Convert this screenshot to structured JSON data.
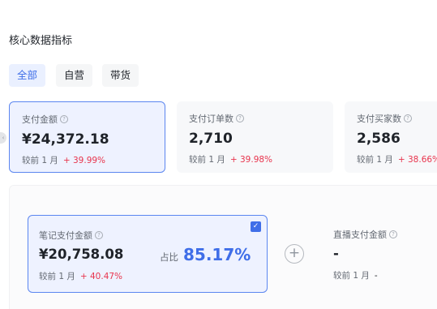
{
  "section": {
    "title": "核心数据指标"
  },
  "tabs": [
    {
      "label": "全部",
      "active": true
    },
    {
      "label": "自营",
      "active": false
    },
    {
      "label": "带货",
      "active": false
    }
  ],
  "metrics": [
    {
      "label": "支付金额",
      "value": "¥24,372.18",
      "compare_label": "较前 1 月",
      "change": "+ 39.99%",
      "active": true
    },
    {
      "label": "支付订单数",
      "value": "2,710",
      "compare_label": "较前 1 月",
      "change": "+ 39.98%",
      "active": false
    },
    {
      "label": "支付买家数",
      "value": "2,586",
      "compare_label": "较前 1 月",
      "change": "+ 38.66%",
      "active": false
    }
  ],
  "breakdown": {
    "notes": {
      "label": "笔记支付金额",
      "value": "¥20,758.08",
      "compare_label": "较前 1 月",
      "change": "+ 40.47%",
      "ratio_label": "占比",
      "ratio_value": "85.17%",
      "selected": true
    },
    "live": {
      "label": "直播支付金额",
      "value": "-",
      "compare_label": "较前 1 月",
      "change": "-"
    }
  },
  "icons": {
    "help": "question-circle-icon",
    "check": "checkmark-icon",
    "plus": "plus-circle-icon",
    "scroll_left": "chevron-left-icon"
  },
  "colors": {
    "accent": "#3f6ee8",
    "increase": "#e8344d",
    "card_active_bg": "#eef2ff"
  }
}
